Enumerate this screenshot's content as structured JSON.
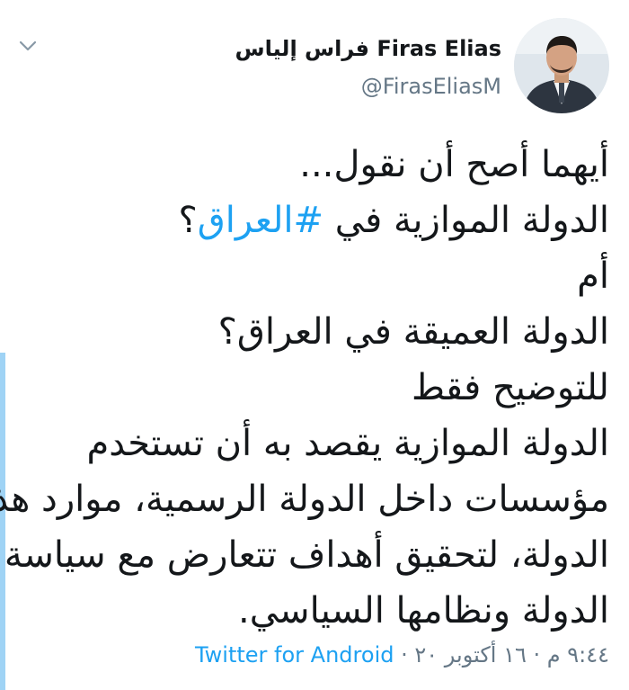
{
  "author": {
    "display_name_ar": "فراس إلياس",
    "display_name_en": "Firas Elias",
    "handle": "@FirasEliasM"
  },
  "tweet": {
    "line1": "أيهما أصح أن نقول...",
    "line2_before": "الدولة الموازية في ",
    "hashtag": "#العراق",
    "line2_after": "؟",
    "line3": "أم",
    "line4": "الدولة العميقة في العراق؟",
    "line5": "للتوضيح فقط",
    "line6": "الدولة الموازية يقصد به أن تستخدم",
    "line7": "مؤسسات داخل الدولة الرسمية، موارد هذه",
    "line8": "الدولة، لتحقيق أهداف تتعارض مع سياسة",
    "line9": "الدولة ونظامها السياسي."
  },
  "meta": {
    "time": "٩:٤٤ م",
    "separator1": " · ",
    "date": "١٦ أكتوبر ٢٠",
    "separator2": " · ",
    "source": "Twitter for Android"
  },
  "icons": {
    "menu": "chevron-down-icon"
  },
  "colors": {
    "link": "#1da1f2",
    "secondary_text": "#657786",
    "primary_text": "#14171a",
    "thread_rail": "#9fd3f5"
  }
}
